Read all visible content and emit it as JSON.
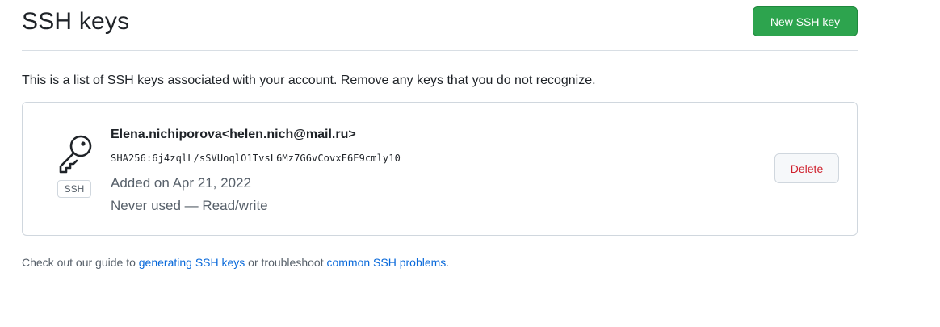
{
  "header": {
    "title": "SSH keys",
    "new_key_button": "New SSH key"
  },
  "intro_text": "This is a list of SSH keys associated with your account. Remove any keys that you do not recognize.",
  "keys": [
    {
      "name": "Elena.nichiporova<helen.nich@mail.ru>",
      "fingerprint": "SHA256:6j4zqlL/sSVUoqlO1TvsL6Mz7G6vCovxF6E9cmly10",
      "added": "Added on Apr 21, 2022",
      "usage": "Never used — Read/write",
      "badge": "SSH",
      "delete_label": "Delete"
    }
  ],
  "footer": {
    "prefix": "Check out our guide to ",
    "link1": "generating SSH keys",
    "middle": " or troubleshoot ",
    "link2": "common SSH problems",
    "suffix": "."
  },
  "colors": {
    "primary_button": "#2da44e",
    "danger_text": "#cf222e",
    "link": "#0969da"
  },
  "icons": {
    "key": "key-icon"
  }
}
